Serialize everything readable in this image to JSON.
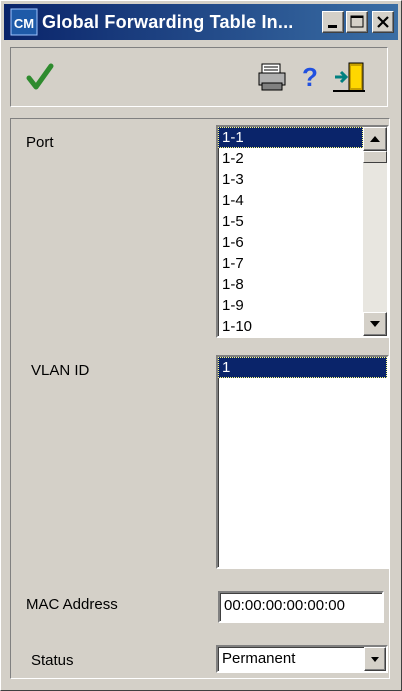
{
  "window": {
    "title": "Global Forwarding Table In...",
    "app_icon_text": "CM"
  },
  "toolbar": {
    "apply_icon": "checkmark-icon",
    "print_icon": "printer-icon",
    "help_icon": "help-icon",
    "exit_icon": "exit-door-icon"
  },
  "form": {
    "port": {
      "label": "Port",
      "items": [
        "1-1",
        "1-2",
        "1-3",
        "1-4",
        "1-5",
        "1-6",
        "1-7",
        "1-8",
        "1-9",
        "1-10"
      ],
      "selected": "1-1"
    },
    "vlan": {
      "label": "VLAN ID",
      "items": [
        "1"
      ],
      "selected": "1"
    },
    "mac": {
      "label": "MAC Address",
      "value": "00:00:00:00:00:00"
    },
    "status": {
      "label": "Status",
      "value": "Permanent"
    }
  },
  "colors": {
    "titlebar": "#0a246a",
    "selection": "#0a246a",
    "face": "#d4d0c8"
  }
}
